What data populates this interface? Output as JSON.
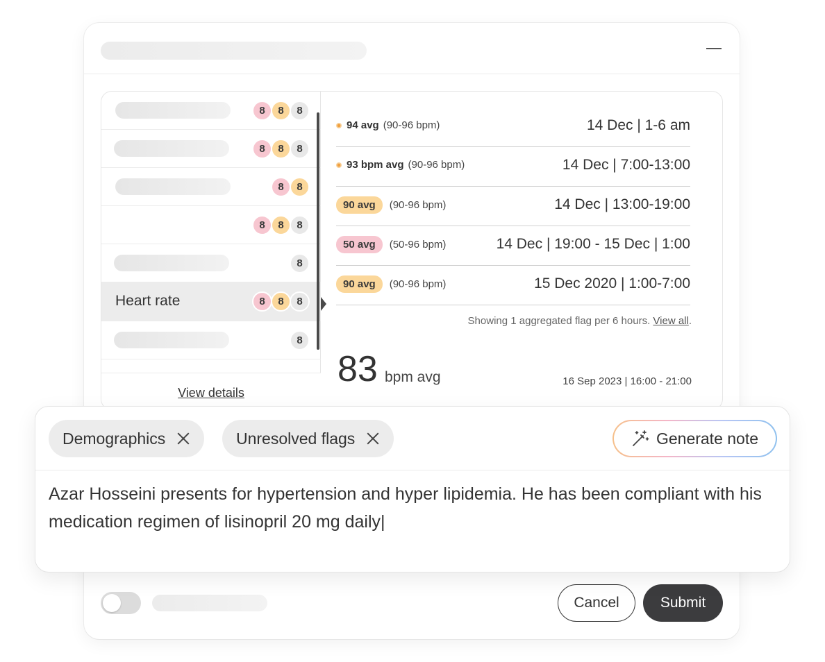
{
  "list": {
    "rows": [
      {
        "label": "",
        "badges": [
          "8",
          "8",
          "8"
        ]
      },
      {
        "label": "",
        "badges": [
          "8",
          "8",
          "8"
        ]
      },
      {
        "label": "",
        "badges": [
          "8",
          "8"
        ]
      },
      {
        "label": "",
        "badges": [
          "8",
          "8",
          "8"
        ]
      },
      {
        "label": "",
        "badges": [
          "8"
        ]
      },
      {
        "label": "Heart rate",
        "badges": [
          "8",
          "8",
          "8"
        ]
      },
      {
        "label": "",
        "badges": [
          "8"
        ]
      }
    ],
    "view_details": "View details"
  },
  "flags": [
    {
      "avg": "94 avg",
      "range": "(90-96 bpm)",
      "date": "14 Dec | 1-6 am"
    },
    {
      "avg": "93 bpm avg",
      "range": "(90-96 bpm)",
      "date": "14 Dec | 7:00-13:00"
    },
    {
      "avg": "90 avg",
      "range": "(90-96 bpm)",
      "date": "14 Dec | 13:00-19:00"
    },
    {
      "avg": "50 avg",
      "range": "(50-96 bpm)",
      "date": "14 Dec | 19:00 - 15 Dec | 1:00"
    },
    {
      "avg": "90 avg",
      "range": "(90-96 bpm)",
      "date": "15 Dec 2020 | 1:00-7:00"
    }
  ],
  "showing_text": "Showing 1 aggregated flag per 6 hours.",
  "view_all": "View all",
  "summary": {
    "value": "83",
    "unit": "bpm avg",
    "date": "16 Sep 2023 | 16:00 - 21:00"
  },
  "note_card": {
    "chips": [
      "Demographics",
      "Unresolved flags"
    ],
    "generate_label": "Generate note",
    "note_text": "Azar Hosseini presents for hypertension and hyper lipidemia. He has been compliant with his medication regimen of lisinopril 20 mg daily|"
  },
  "footer": {
    "cancel": "Cancel",
    "submit": "Submit"
  },
  "colors": {
    "pink": "#f7c6d0",
    "orange": "#fbd79a",
    "gray": "#e8e8e8",
    "submit": "#3c3c3e"
  }
}
